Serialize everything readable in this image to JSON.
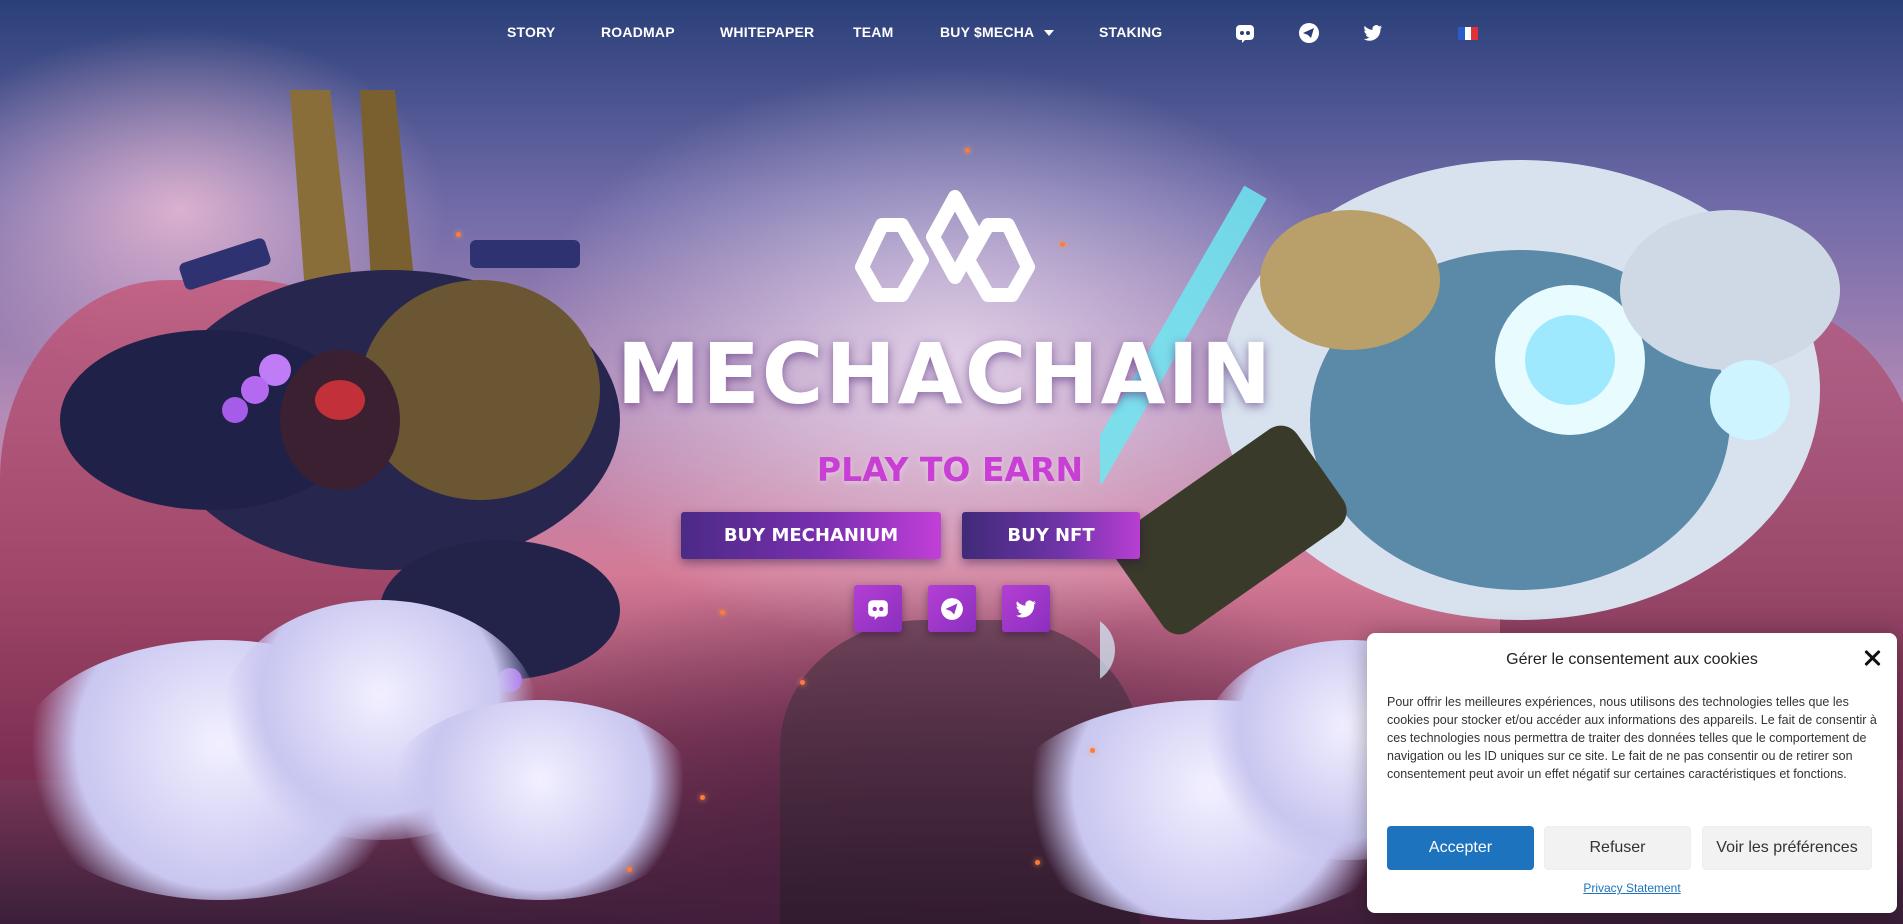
{
  "nav": {
    "links": [
      "STORY",
      "ROADMAP",
      "WHITEPAPER",
      "TEAM",
      "BUY $MECHA",
      "STAKING"
    ],
    "icons": [
      "discord-icon",
      "telegram-icon",
      "twitter-icon"
    ],
    "language_flag": "french-flag"
  },
  "hero": {
    "brand": "MECHACHAIN",
    "tagline": "PLAY TO EARN",
    "buttons": {
      "buy_mechanium": "BUY MECHANIUM",
      "buy_nft": "BUY NFT"
    },
    "social": [
      "discord-icon",
      "telegram-icon",
      "twitter-icon"
    ]
  },
  "cookie": {
    "title": "Gérer le consentement aux cookies",
    "body": "Pour offrir les meilleures expériences, nous utilisons des technologies telles que les cookies pour stocker et/ou accéder aux informations des appareils. Le fait de consentir à ces technologies nous permettra de traiter des données telles que le comportement de navigation ou les ID uniques sur ce site. Le fait de ne pas consentir ou de retirer son consentement peut avoir un effet négatif sur certaines caractéristiques et fonctions.",
    "accept": "Accepter",
    "refuse": "Refuser",
    "preferences": "Voir les préférences",
    "privacy": "Privacy Statement"
  },
  "colors": {
    "accent_purple": "#c93fd6",
    "button_blue": "#1e73be"
  }
}
